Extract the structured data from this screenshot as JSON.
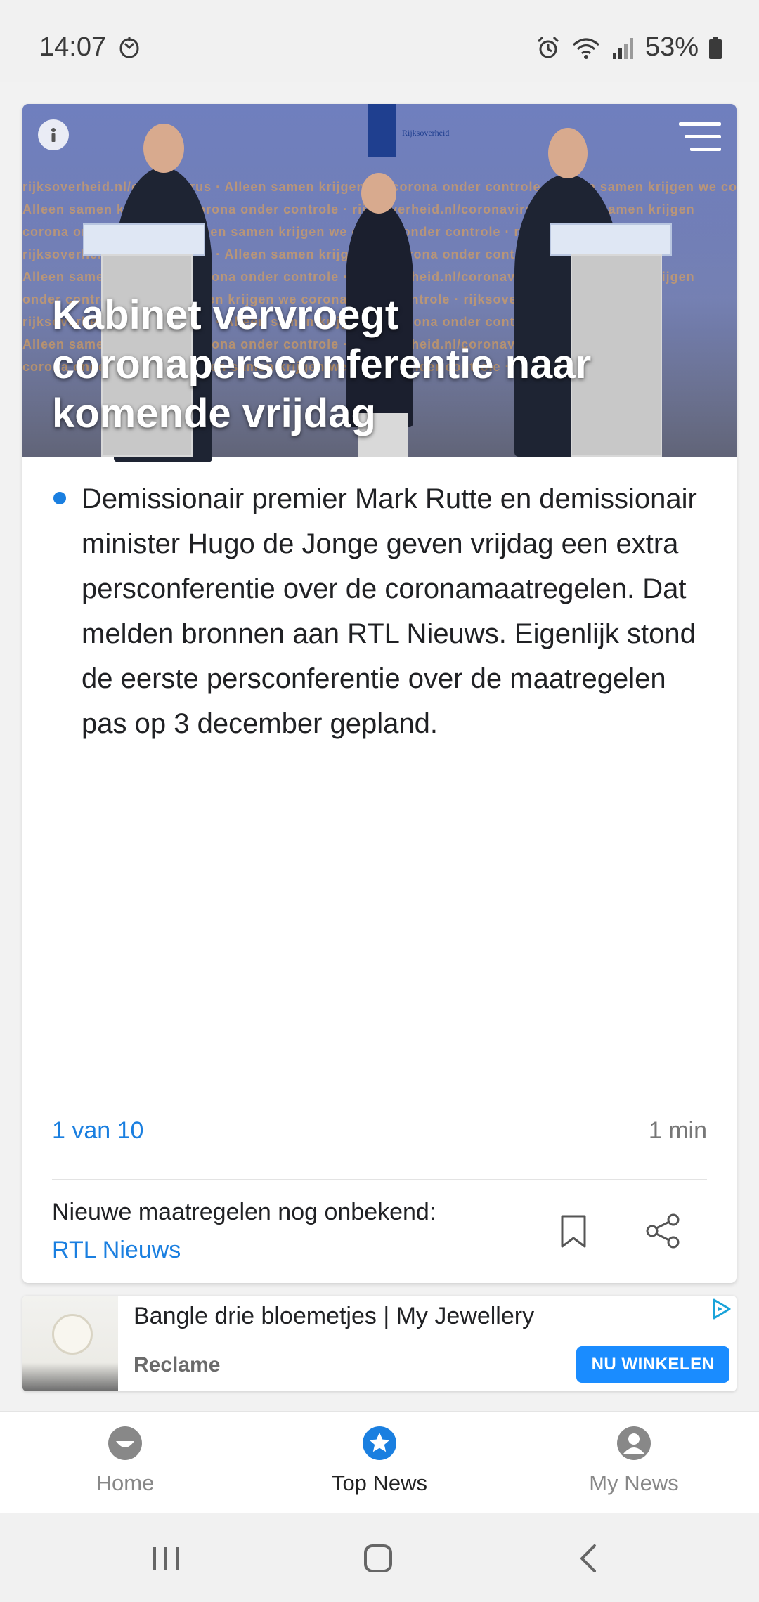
{
  "status_bar": {
    "time": "14:07",
    "battery": "53%"
  },
  "article": {
    "title": "Kabinet vervroegt coronapersconferentie naar komende vrijdag",
    "summary": "Demissionair premier Mark Rutte en demissionair minister Hugo de Jonge geven vrijdag een extra persconferentie over de coronamaatregelen. Dat melden bronnen aan RTL Nieuws. Eigenlijk stond de eerste persconferentie over de maatregelen pas op 3 december gepland.",
    "counter": "1 van 10",
    "read_time": "1 min",
    "source_headline": "Nieuwe maatregelen nog onbekend:",
    "source_name": "RTL Nieuws",
    "hero_emblem_text": "Rijksoverheid"
  },
  "ad": {
    "title": "Bangle drie bloemetjes | My Jewellery",
    "label": "Reclame",
    "cta": "NU WINKELEN"
  },
  "bottom_nav": {
    "items": [
      {
        "label": "Home",
        "active": false
      },
      {
        "label": "Top News",
        "active": true
      },
      {
        "label": "My News",
        "active": false
      }
    ]
  },
  "colors": {
    "accent": "#1a7fe0",
    "cta": "#1a8cff"
  }
}
